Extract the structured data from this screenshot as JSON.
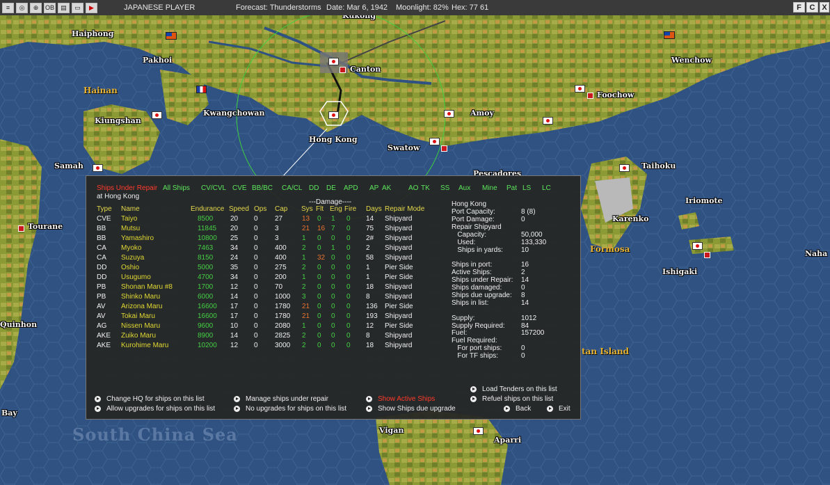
{
  "topbar": {
    "player": "JAPANESE PLAYER",
    "forecast": "Forecast: Thunderstorms",
    "date": "Date: Mar 6, 1942",
    "moonlight": "Moonlight: 82%",
    "hex": "Hex: 77 61",
    "right_buttons": [
      "F",
      "C",
      "X"
    ]
  },
  "map": {
    "cities": [
      "Kukong",
      "Haiphong",
      "Pakhoi",
      "Canton",
      "Wenchow",
      "Foochow",
      "Kwangchowan",
      "Amoy",
      "Kiungshan",
      "Hong Kong",
      "Swatow",
      "Samah",
      "Taihoku",
      "Iriomote",
      "Tourane",
      "Karenko",
      "Naha",
      "Ishigaki",
      "Quinhon",
      "Bay",
      "Vigan",
      "Aparri",
      "Pescadores"
    ],
    "regions": [
      "Hainan",
      "Formosa",
      "tan Island"
    ],
    "seas": [
      "South China Sea"
    ]
  },
  "panel": {
    "filters": [
      {
        "label": "Ships Under Repair",
        "active": true
      },
      {
        "label": "All Ships",
        "active": false
      },
      {
        "label": "CV/CVL",
        "active": false
      },
      {
        "label": "CVE",
        "active": false
      },
      {
        "label": "BB/BC",
        "active": false
      },
      {
        "label": "CA/CL",
        "active": false
      },
      {
        "label": "DD",
        "active": false
      },
      {
        "label": "DE",
        "active": false
      },
      {
        "label": "APD",
        "active": false
      },
      {
        "label": "AP",
        "active": false
      },
      {
        "label": "AK",
        "active": false
      },
      {
        "label": "AO",
        "active": false
      },
      {
        "label": "TK",
        "active": false
      },
      {
        "label": "SS",
        "active": false
      },
      {
        "label": "Aux",
        "active": false
      },
      {
        "label": "Mine",
        "active": false
      },
      {
        "label": "Pat",
        "active": false
      },
      {
        "label": "LS",
        "active": false
      },
      {
        "label": "LC",
        "active": false
      }
    ],
    "location": "at Hong Kong",
    "damage_header": "---Damage----",
    "columns": {
      "type": "Type",
      "name": "Name",
      "endurance": "Endurance",
      "speed": "Speed",
      "ops": "Ops",
      "cap": "Cap",
      "sys": "Sys",
      "flt": "Flt",
      "eng": "Eng",
      "fire": "Fire",
      "days": "Days",
      "mode": "Repair Mode"
    },
    "ships": [
      {
        "type": "CVE",
        "name": "Taiyo",
        "endurance": "8500",
        "speed": "20",
        "ops": "0",
        "cap": "27",
        "sys": "13",
        "flt": "0",
        "eng": "1",
        "fire": "0",
        "days": "14",
        "mode": "Shipyard",
        "sys_c": "o",
        "flt_c": "g",
        "eng_c": "g"
      },
      {
        "type": "BB",
        "name": "Mutsu",
        "endurance": "11845",
        "speed": "20",
        "ops": "0",
        "cap": "3",
        "sys": "21",
        "flt": "16",
        "eng": "7",
        "fire": "0",
        "days": "75",
        "mode": "Shipyard",
        "sys_c": "o",
        "flt_c": "o",
        "eng_c": "g"
      },
      {
        "type": "BB",
        "name": "Yamashiro",
        "endurance": "10800",
        "speed": "25",
        "ops": "0",
        "cap": "3",
        "sys": "1",
        "flt": "0",
        "eng": "0",
        "fire": "0",
        "days": "2#",
        "mode": "Shipyard",
        "sys_c": "g",
        "flt_c": "g",
        "eng_c": "g"
      },
      {
        "type": "CA",
        "name": "Myoko",
        "endurance": "7463",
        "speed": "34",
        "ops": "0",
        "cap": "400",
        "sys": "2",
        "flt": "0",
        "eng": "1",
        "fire": "0",
        "days": "2",
        "mode": "Shipyard",
        "sys_c": "g",
        "flt_c": "g",
        "eng_c": "g"
      },
      {
        "type": "CA",
        "name": "Suzuya",
        "endurance": "8150",
        "speed": "24",
        "ops": "0",
        "cap": "400",
        "sys": "1",
        "flt": "32",
        "eng": "0",
        "fire": "0",
        "days": "58",
        "mode": "Shipyard",
        "sys_c": "g",
        "flt_c": "o",
        "eng_c": "g"
      },
      {
        "type": "DD",
        "name": "Oshio",
        "endurance": "5000",
        "speed": "35",
        "ops": "0",
        "cap": "275",
        "sys": "2",
        "flt": "0",
        "eng": "0",
        "fire": "0",
        "days": "1",
        "mode": "Pier Side",
        "sys_c": "g",
        "flt_c": "g",
        "eng_c": "g"
      },
      {
        "type": "DD",
        "name": "Usugumo",
        "endurance": "4700",
        "speed": "34",
        "ops": "0",
        "cap": "200",
        "sys": "1",
        "flt": "0",
        "eng": "0",
        "fire": "0",
        "days": "1",
        "mode": "Pier Side",
        "sys_c": "g",
        "flt_c": "g",
        "eng_c": "g"
      },
      {
        "type": "PB",
        "name": "Shonan Maru #8",
        "endurance": "1700",
        "speed": "12",
        "ops": "0",
        "cap": "70",
        "sys": "2",
        "flt": "0",
        "eng": "0",
        "fire": "0",
        "days": "18",
        "mode": "Shipyard",
        "sys_c": "g",
        "flt_c": "g",
        "eng_c": "g"
      },
      {
        "type": "PB",
        "name": "Shinko Maru",
        "endurance": "6000",
        "speed": "14",
        "ops": "0",
        "cap": "1000",
        "sys": "3",
        "flt": "0",
        "eng": "0",
        "fire": "0",
        "days": "8",
        "mode": "Shipyard",
        "sys_c": "g",
        "flt_c": "g",
        "eng_c": "g"
      },
      {
        "type": "AV",
        "name": "Arizona Maru",
        "endurance": "16600",
        "speed": "17",
        "ops": "0",
        "cap": "1780",
        "sys": "21",
        "flt": "0",
        "eng": "0",
        "fire": "0",
        "days": "136",
        "mode": "Pier Side",
        "sys_c": "o",
        "flt_c": "g",
        "eng_c": "g"
      },
      {
        "type": "AV",
        "name": "Tokai Maru",
        "endurance": "16600",
        "speed": "17",
        "ops": "0",
        "cap": "1780",
        "sys": "21",
        "flt": "0",
        "eng": "0",
        "fire": "0",
        "days": "193",
        "mode": "Shipyard",
        "sys_c": "o",
        "flt_c": "g",
        "eng_c": "g"
      },
      {
        "type": "AG",
        "name": "Nissen Maru",
        "endurance": "9600",
        "speed": "10",
        "ops": "0",
        "cap": "2080",
        "sys": "1",
        "flt": "0",
        "eng": "0",
        "fire": "0",
        "days": "12",
        "mode": "Pier Side",
        "sys_c": "g",
        "flt_c": "g",
        "eng_c": "g"
      },
      {
        "type": "AKE",
        "name": "Zuiko Maru",
        "endurance": "8900",
        "speed": "14",
        "ops": "0",
        "cap": "2825",
        "sys": "2",
        "flt": "0",
        "eng": "0",
        "fire": "0",
        "days": "8",
        "mode": "Shipyard",
        "sys_c": "g",
        "flt_c": "g",
        "eng_c": "g"
      },
      {
        "type": "AKE",
        "name": "Kurohime Maru",
        "endurance": "10200",
        "speed": "12",
        "ops": "0",
        "cap": "3000",
        "sys": "2",
        "flt": "0",
        "eng": "0",
        "fire": "0",
        "days": "18",
        "mode": "Shipyard",
        "sys_c": "g",
        "flt_c": "g",
        "eng_c": "g"
      }
    ],
    "info": {
      "base_name": "Hong Kong",
      "lines": [
        [
          "Port Capacity:",
          "8 (8)"
        ],
        [
          "Port Damage:",
          "0"
        ],
        [
          "Repair Shipyard",
          ""
        ],
        [
          "   Capacity:",
          "50,000"
        ],
        [
          "   Used:",
          "133,330"
        ],
        [
          "   Ships in yards:",
          "10"
        ],
        [
          "",
          ""
        ],
        [
          "Ships in port:",
          "16"
        ],
        [
          "Active Ships:",
          "2"
        ],
        [
          "Ships under Repair:",
          "14"
        ],
        [
          "Ships damaged:",
          "0"
        ],
        [
          "Ships due upgrade:",
          "8"
        ],
        [
          "Ships in list:",
          "14"
        ],
        [
          "",
          ""
        ],
        [
          "Supply:",
          "1012"
        ],
        [
          "Supply Required:",
          "84"
        ],
        [
          "Fuel:",
          "157200"
        ],
        [
          "Fuel Required:",
          ""
        ],
        [
          "   For port ships:",
          "0"
        ],
        [
          "   For TF ships:",
          "0"
        ]
      ]
    },
    "actions": {
      "change_hq": "Change HQ for ships on this list",
      "allow_upgrades": "Allow upgrades for ships on this list",
      "manage_repair": "Manage ships under repair",
      "no_upgrades": "No upgrades for ships on this list",
      "show_active": "Show Active Ships",
      "show_due_upgrade": "Show Ships due upgrade",
      "load_tenders": "Load Tenders on this list",
      "refuel": "Refuel ships on this list",
      "back": "Back",
      "exit": "Exit"
    }
  }
}
